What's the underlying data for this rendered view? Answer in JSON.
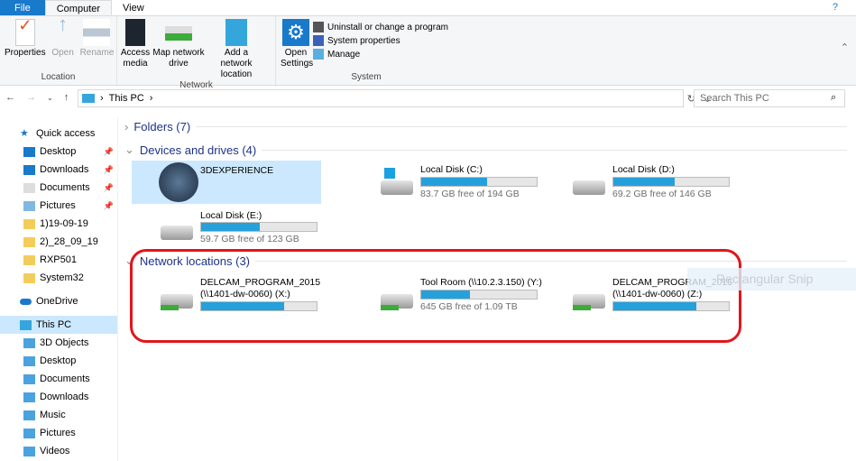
{
  "tabs": {
    "file": "File",
    "computer": "Computer",
    "view": "View"
  },
  "ribbon": {
    "location": {
      "label": "Location",
      "properties": "Properties",
      "open": "Open",
      "rename": "Rename"
    },
    "network": {
      "label": "Network",
      "access_media": "Access media",
      "map_drive": "Map network drive",
      "add_location": "Add a network location"
    },
    "system": {
      "label": "System",
      "open_settings": "Open Settings",
      "uninstall": "Uninstall or change a program",
      "system_properties": "System properties",
      "manage": "Manage"
    }
  },
  "address": {
    "path": "This PC",
    "search_placeholder": "Search This PC"
  },
  "sidebar": {
    "quick_access": "Quick access",
    "qa_items": [
      "Desktop",
      "Downloads",
      "Documents",
      "Pictures",
      "1)19-09-19",
      "2)_28_09_19",
      "RXP501",
      "System32"
    ],
    "onedrive": "OneDrive",
    "this_pc": "This PC",
    "pc_items": [
      "3D Objects",
      "Desktop",
      "Documents",
      "Downloads",
      "Music",
      "Pictures",
      "Videos"
    ]
  },
  "sections": {
    "folders": "Folders (7)",
    "devices": "Devices and drives (4)",
    "network": "Network locations (3)"
  },
  "devices": [
    {
      "name": "3DEXPERIENCE"
    },
    {
      "name": "Local Disk (C:)",
      "free": "83.7 GB free of 194 GB",
      "used_pct": 57
    },
    {
      "name": "Local Disk (D:)",
      "free": "69.2 GB free of 146 GB",
      "used_pct": 53
    },
    {
      "name": "Local Disk (E:)",
      "free": "59.7 GB free of 123 GB",
      "used_pct": 51
    }
  ],
  "network_drives": [
    {
      "name": "DELCAM_PROGRAM_2015",
      "name2": "(\\\\1401-dw-0060) (X:)",
      "used_pct": 72
    },
    {
      "name": "Tool Room (\\\\10.2.3.150) (Y:)",
      "free": "645 GB free of 1.09 TB",
      "used_pct": 42
    },
    {
      "name": "DELCAM_PROGRAM_2015",
      "name2": "(\\\\1401-dw-0060) (Z:)",
      "used_pct": 72
    }
  ],
  "overlay": {
    "snip": "Rectangular Snip"
  },
  "colors": {
    "accent": "#1979ca",
    "bar": "#26a0da",
    "highlight": "#e0161b"
  }
}
